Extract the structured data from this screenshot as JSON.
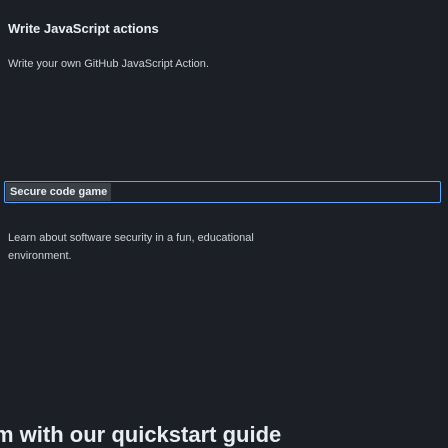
{
  "card1": {
    "title": "Write JavaScript actions",
    "description": "Write your own GitHub JavaScript Action."
  },
  "card2": {
    "title": "Secure code game",
    "description": "Learn about software security in a fun, educational environment."
  },
  "footer": {
    "heading": "m with our quickstart guide"
  },
  "colors": {
    "background": "#1c2026",
    "focus_outline": "#58a6ff",
    "text": "#e6edf3"
  }
}
